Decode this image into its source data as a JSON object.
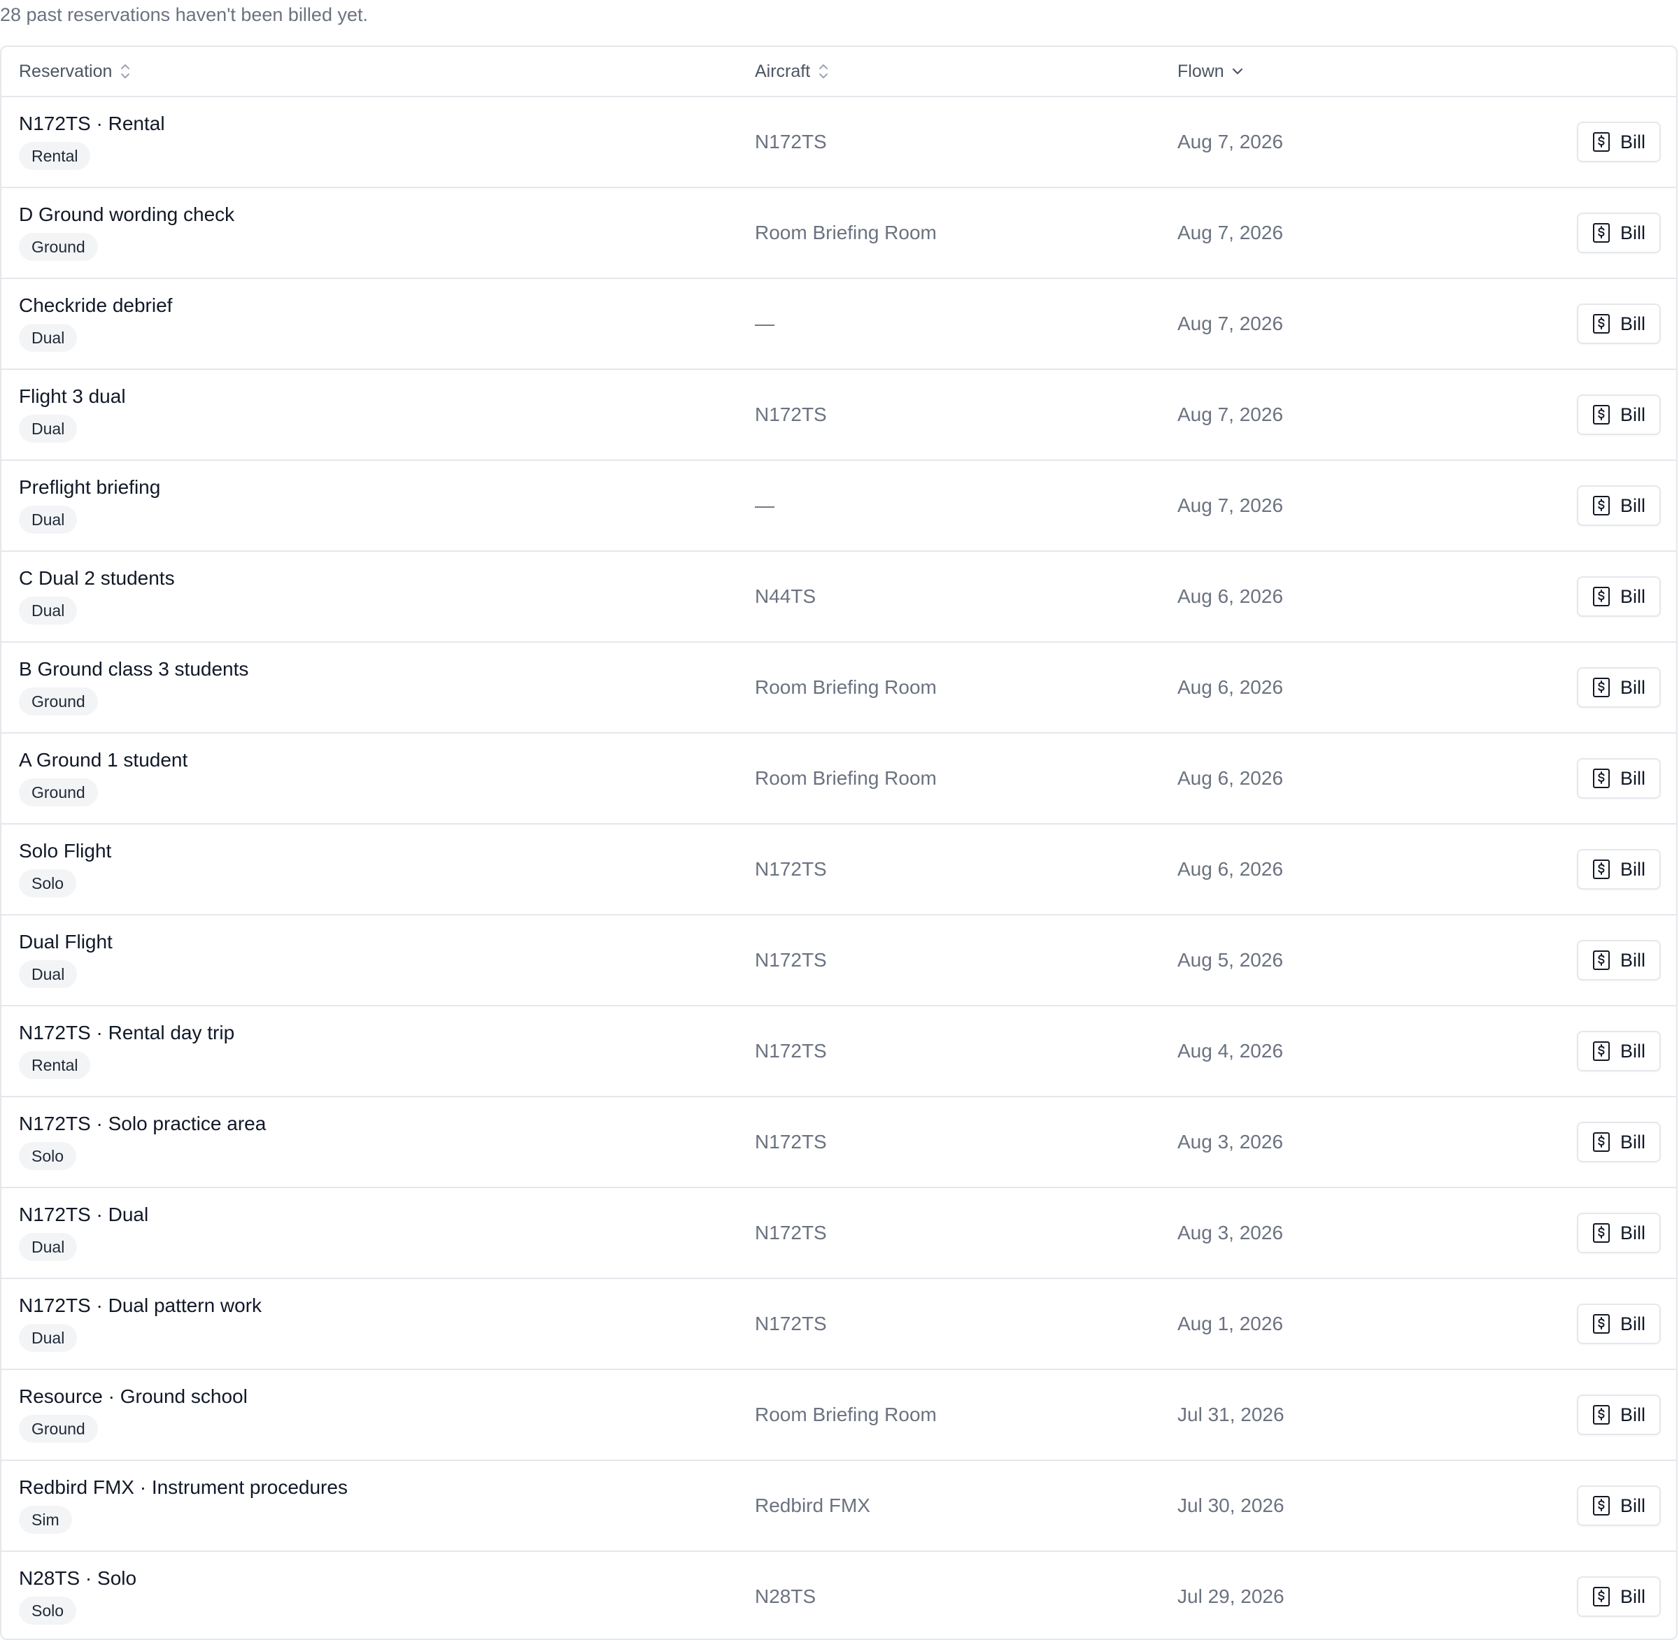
{
  "summary": "28 past reservations haven't been billed yet.",
  "table": {
    "columns": {
      "reservation": "Reservation",
      "aircraft": "Aircraft",
      "flown": "Flown"
    },
    "sort_icons": {
      "reservation": "sort-icon",
      "aircraft": "sort-icon",
      "flown": "chevron-down-icon"
    },
    "bill_label": "Bill",
    "bill_icon": "receipt-dollar-icon",
    "rows": [
      {
        "title": "N172TS · Rental",
        "type": "Rental",
        "aircraft": "N172TS",
        "flown": "Aug 7, 2026"
      },
      {
        "title": "D Ground wording check",
        "type": "Ground",
        "aircraft": "Room Briefing Room",
        "flown": "Aug 7, 2026"
      },
      {
        "title": "Checkride debrief",
        "type": "Dual",
        "aircraft": "—",
        "flown": "Aug 7, 2026"
      },
      {
        "title": "Flight 3 dual",
        "type": "Dual",
        "aircraft": "N172TS",
        "flown": "Aug 7, 2026"
      },
      {
        "title": "Preflight briefing",
        "type": "Dual",
        "aircraft": "—",
        "flown": "Aug 7, 2026"
      },
      {
        "title": "C Dual 2 students",
        "type": "Dual",
        "aircraft": "N44TS",
        "flown": "Aug 6, 2026"
      },
      {
        "title": "B Ground class 3 students",
        "type": "Ground",
        "aircraft": "Room Briefing Room",
        "flown": "Aug 6, 2026"
      },
      {
        "title": "A Ground 1 student",
        "type": "Ground",
        "aircraft": "Room Briefing Room",
        "flown": "Aug 6, 2026"
      },
      {
        "title": "Solo Flight",
        "type": "Solo",
        "aircraft": "N172TS",
        "flown": "Aug 6, 2026"
      },
      {
        "title": "Dual Flight",
        "type": "Dual",
        "aircraft": "N172TS",
        "flown": "Aug 5, 2026"
      },
      {
        "title": "N172TS · Rental day trip",
        "type": "Rental",
        "aircraft": "N172TS",
        "flown": "Aug 4, 2026"
      },
      {
        "title": "N172TS · Solo practice area",
        "type": "Solo",
        "aircraft": "N172TS",
        "flown": "Aug 3, 2026"
      },
      {
        "title": "N172TS · Dual",
        "type": "Dual",
        "aircraft": "N172TS",
        "flown": "Aug 3, 2026"
      },
      {
        "title": "N172TS · Dual pattern work",
        "type": "Dual",
        "aircraft": "N172TS",
        "flown": "Aug 1, 2026"
      },
      {
        "title": "Resource · Ground school",
        "type": "Ground",
        "aircraft": "Room Briefing Room",
        "flown": "Jul 31, 2026"
      },
      {
        "title": "Redbird FMX · Instrument procedures",
        "type": "Sim",
        "aircraft": "Redbird FMX",
        "flown": "Jul 30, 2026"
      },
      {
        "title": "N28TS · Solo",
        "type": "Solo",
        "aircraft": "N28TS",
        "flown": "Jul 29, 2026"
      }
    ]
  }
}
